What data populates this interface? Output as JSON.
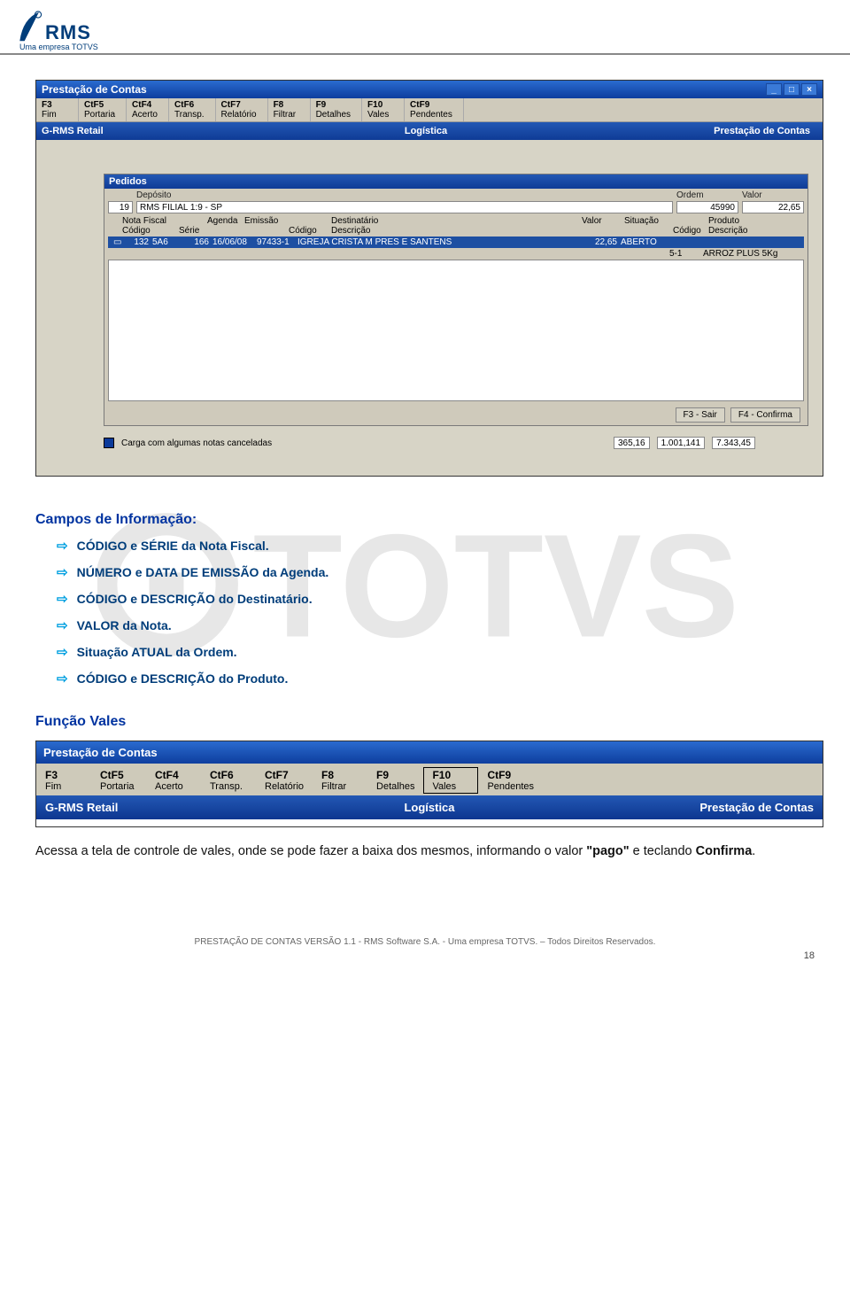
{
  "logo": {
    "text": "RMS",
    "sub": "Uma empresa TOTVS"
  },
  "screenshot1": {
    "title": "Prestação de Contas",
    "menu": [
      {
        "k": "F3",
        "l": "Fim"
      },
      {
        "k": "CtF5",
        "l": "Portaria"
      },
      {
        "k": "CtF4",
        "l": "Acerto"
      },
      {
        "k": "CtF6",
        "l": "Transp."
      },
      {
        "k": "CtF7",
        "l": "Relatório"
      },
      {
        "k": "F8",
        "l": "Filtrar"
      },
      {
        "k": "F9",
        "l": "Detalhes"
      },
      {
        "k": "F10",
        "l": "Vales"
      },
      {
        "k": "CtF9",
        "l": "Pendentes"
      }
    ],
    "bluebar": {
      "left": "G-RMS Retail",
      "center": "Logística",
      "right": "Prestação de Contas"
    },
    "panel": {
      "title": "Pedidos",
      "deposito_label": "Depósito",
      "deposito_code": "19",
      "deposito_name": "RMS FILIAL 1:9 - SP",
      "ordem_label": "Ordem",
      "ordem_value": "45990",
      "valor_label": "Valor",
      "valor_value": "22,65",
      "headers": {
        "nf": "Nota Fiscal",
        "codigo": "Código",
        "serie": "Série",
        "agenda": "Agenda",
        "emissao": "Emissão",
        "dest": "Destinatário",
        "dest_cod": "Código",
        "dest_desc": "Descrição",
        "val": "Valor",
        "sit": "Situação",
        "prod": "Produto",
        "prod_cod": "Código",
        "prod_desc": "Descrição"
      },
      "row": {
        "codigo": "132",
        "serie": "5A6",
        "agenda": "166",
        "emissao": "16/06/08",
        "dest_cod": "97433-1",
        "dest_desc": "IGREJA CRISTA M PRES E SANTENS",
        "valor": "22,65",
        "sit": "ABERTO",
        "prod_cod": "5-1",
        "prod_desc": "ARROZ PLUS 5Kg"
      },
      "btn_sair": "F3 - Sair",
      "btn_conf": "F4 - Confirma"
    },
    "bottom": {
      "text": "Carga com algumas notas canceladas",
      "c1": "365,16",
      "c2": "1.001,141",
      "c3": "7.343,45"
    }
  },
  "doc": {
    "heading1": "Campos de Informação:",
    "bullets": [
      "CÓDIGO e SÉRIE da Nota Fiscal.",
      "NÚMERO e DATA DE EMISSÃO da Agenda.",
      "CÓDIGO e DESCRIÇÃO do Destinatário.",
      "VALOR da Nota.",
      "Situação ATUAL da Ordem.",
      "CÓDIGO e DESCRIÇÃO do Produto."
    ],
    "heading2": "Função Vales",
    "body": "Acessa a tela de controle de vales, onde se pode fazer a baixa dos mesmos, informando o valor \"pago\" e teclando Confirma."
  },
  "screenshot2": {
    "title": "Prestação de Contas",
    "menu": [
      {
        "k": "F3",
        "l": "Fim"
      },
      {
        "k": "CtF5",
        "l": "Portaria"
      },
      {
        "k": "CtF4",
        "l": "Acerto"
      },
      {
        "k": "CtF6",
        "l": "Transp."
      },
      {
        "k": "CtF7",
        "l": "Relatório"
      },
      {
        "k": "F8",
        "l": "Filtrar"
      },
      {
        "k": "F9",
        "l": "Detalhes"
      },
      {
        "k": "F10",
        "l": "Vales"
      },
      {
        "k": "CtF9",
        "l": "Pendentes"
      }
    ],
    "bluebar": {
      "left": "G-RMS Retail",
      "center": "Logística",
      "right": "Prestação de Contas"
    }
  },
  "footer": "PRESTAÇÃO DE CONTAS VERSÃO 1.1 - RMS Software S.A. - Uma empresa TOTVS. – Todos Direitos Reservados.",
  "page": "18"
}
